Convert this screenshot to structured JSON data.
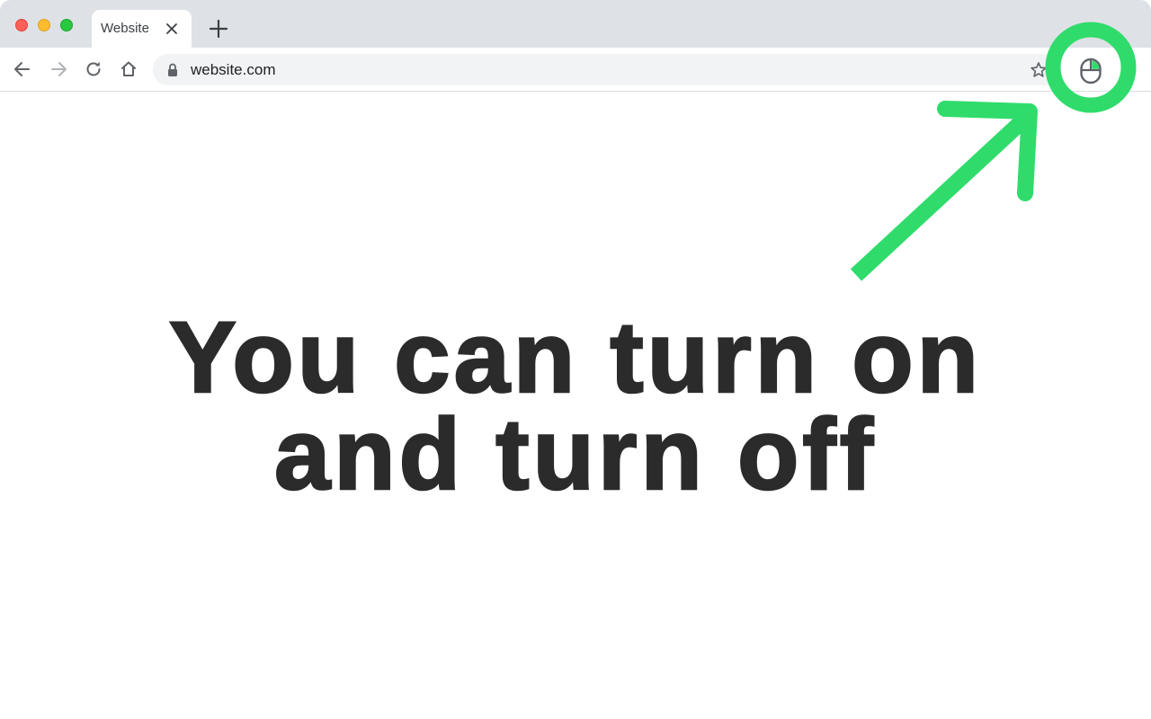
{
  "browser": {
    "tab": {
      "title": "Website"
    },
    "address_bar": {
      "url": "website.com"
    },
    "icons": {
      "back": "arrow-left-icon",
      "forward": "arrow-right-icon",
      "reload": "reload-icon",
      "home": "home-icon",
      "lock": "lock-icon",
      "bookmark": "star-icon",
      "extension": "mouse-icon",
      "close_tab": "close-icon",
      "new_tab": "plus-icon"
    }
  },
  "content": {
    "headline_line1": "You can turn on",
    "headline_line2": "and turn off"
  },
  "colors": {
    "highlight": "#2fdc6b",
    "headline": "#2b2b2b",
    "tabstrip": "#dee1e6",
    "omnibox": "#f1f3f4"
  }
}
